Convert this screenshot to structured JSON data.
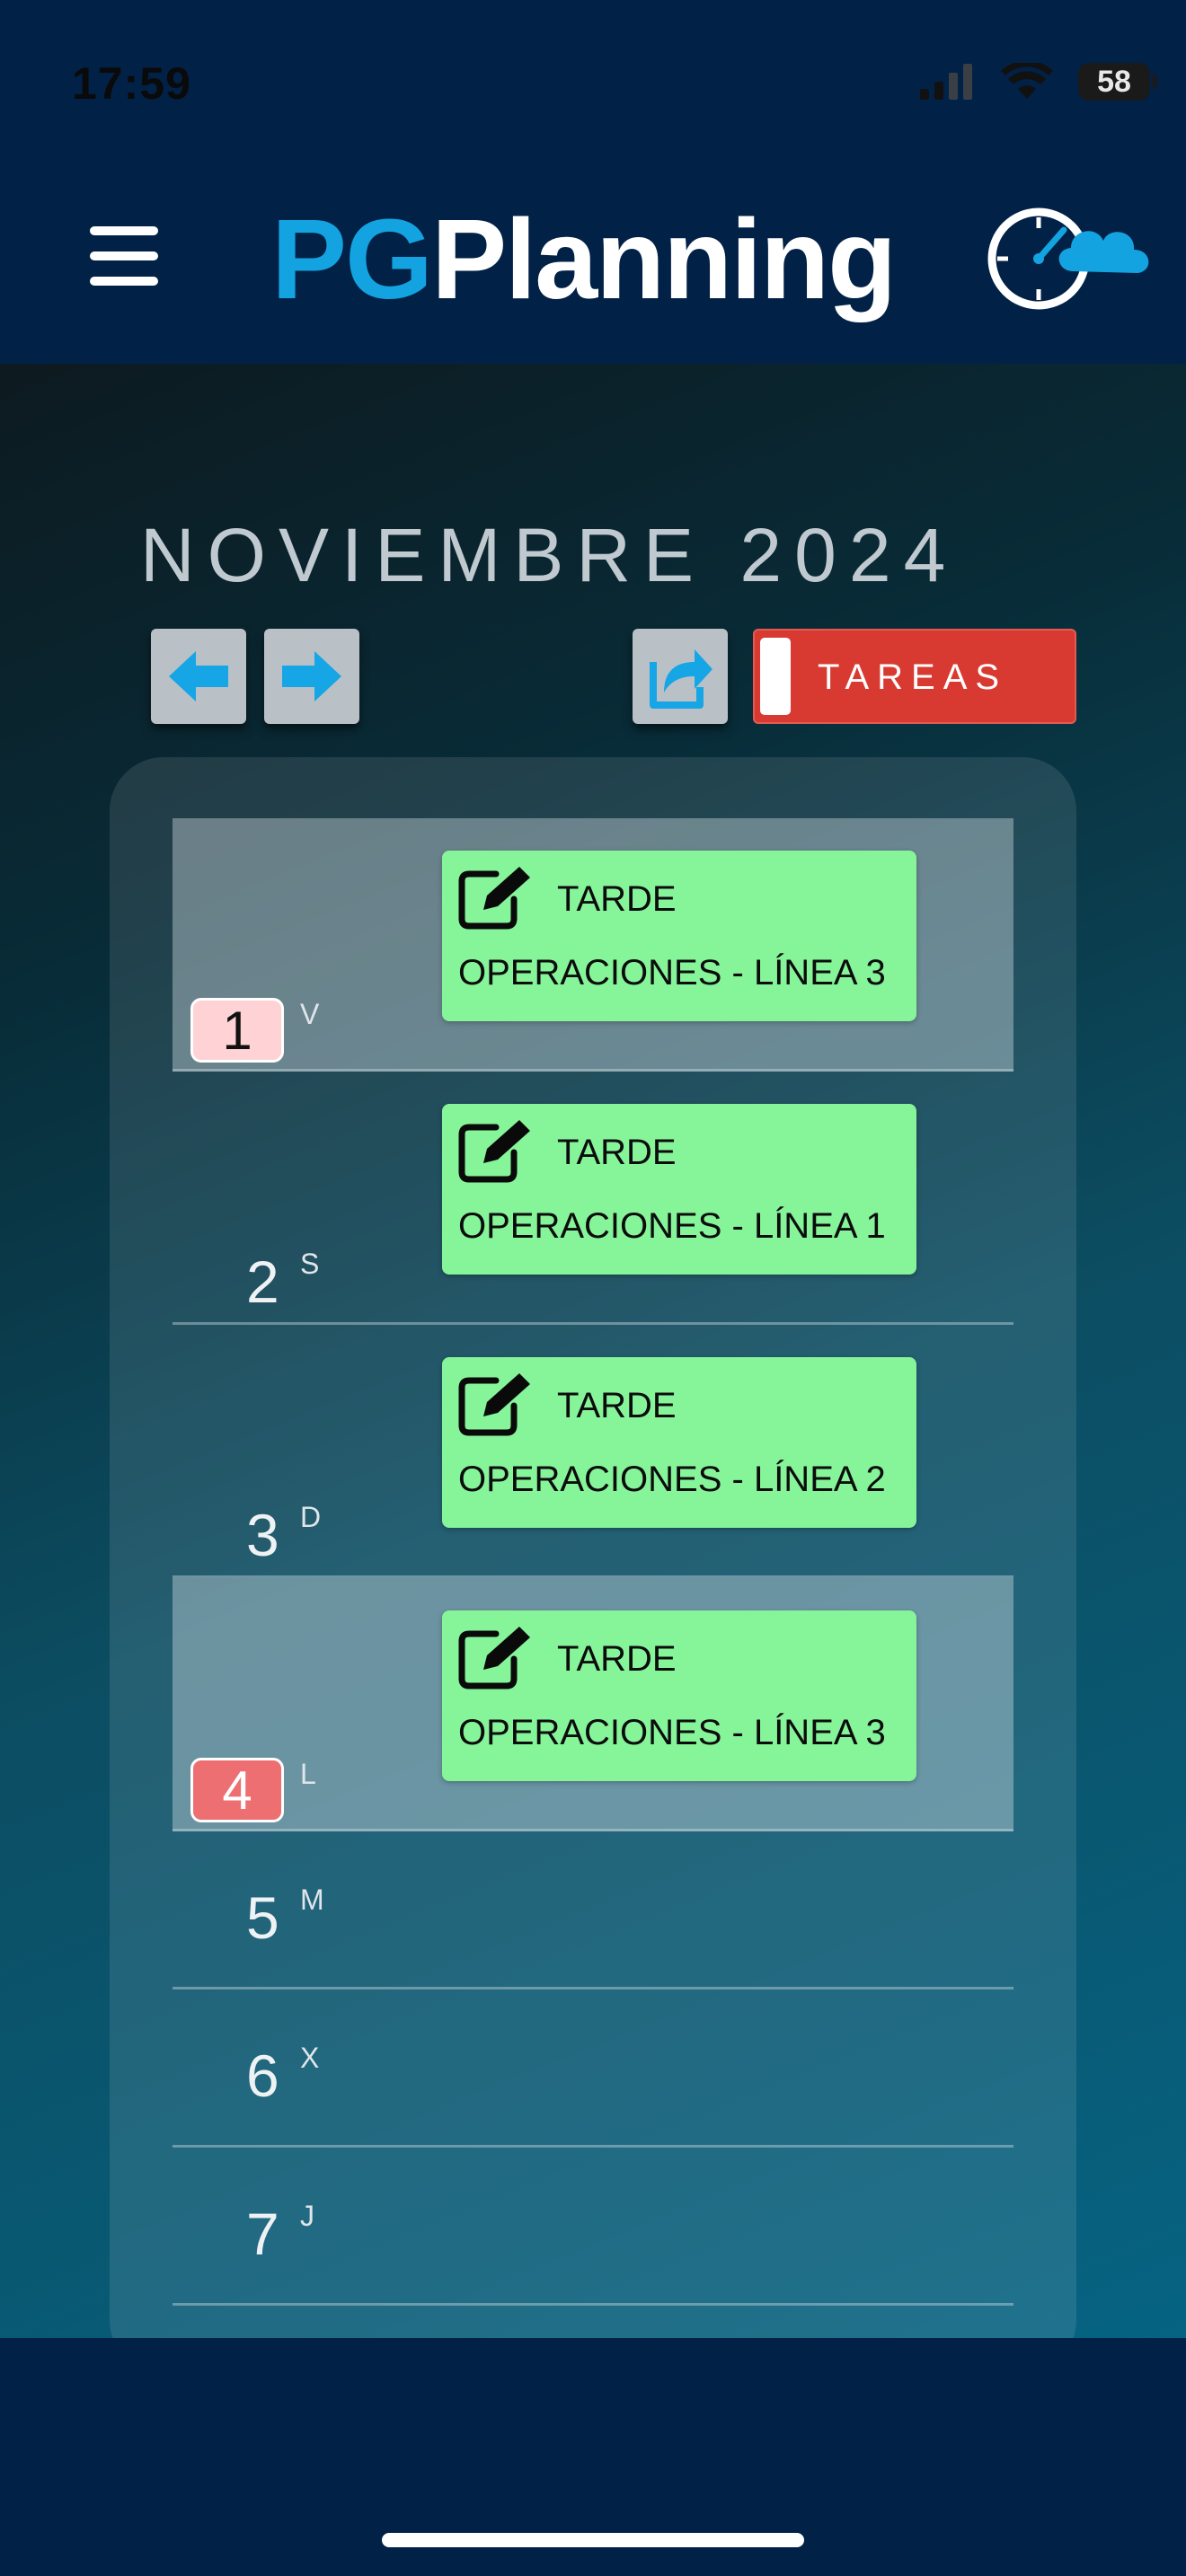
{
  "status_bar": {
    "time": "17:59",
    "battery": "58"
  },
  "header": {
    "logo_pg": "PG",
    "logo_planning": "Planning"
  },
  "calendar": {
    "month_title": "NOVIEMBRE 2024",
    "tareas_label": "TAREAS",
    "days": [
      {
        "num": "1",
        "letter": "V",
        "shift": "TARDE",
        "desc": "OPERACIONES - LÍNEA 3"
      },
      {
        "num": "2",
        "letter": "S",
        "shift": "TARDE",
        "desc": "OPERACIONES - LÍNEA 1"
      },
      {
        "num": "3",
        "letter": "D",
        "shift": "TARDE",
        "desc": "OPERACIONES - LÍNEA 2"
      },
      {
        "num": "4",
        "letter": "L",
        "shift": "TARDE",
        "desc": "OPERACIONES - LÍNEA 3"
      },
      {
        "num": "5",
        "letter": "M"
      },
      {
        "num": "6",
        "letter": "X"
      },
      {
        "num": "7",
        "letter": "J"
      }
    ]
  },
  "colors": {
    "header_bg": "#022146",
    "brand_blue": "#13a3e0",
    "shift_green": "#86f59a",
    "tareas_red": "#d83a32",
    "badge_today": "#ee6f72"
  }
}
